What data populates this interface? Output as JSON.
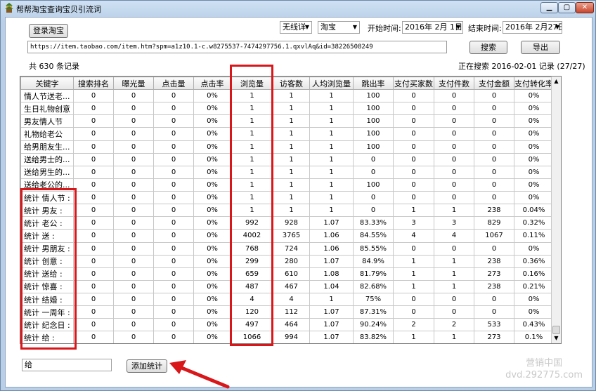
{
  "window": {
    "title": "帮帮淘宝查询宝贝引流词"
  },
  "toolbar": {
    "login_label": "登录淘宝",
    "network_value": "无线详",
    "platform_value": "淘宝",
    "start_label": "开始时间:",
    "start_date": "2016年 2月 1日",
    "end_label": "结束时间:",
    "end_date": "2016年 2月27日",
    "url": "https://item.taobao.com/item.htm?spm=a1z10.1-c.w8275537-7474297756.1.qxvlAq&id=38226508249",
    "search_label": "搜索",
    "export_label": "导出",
    "total_text": "共 630 条记录",
    "status_text": "正在搜索 2016-02-01 记录 (27/27)"
  },
  "table": {
    "headers": [
      "关键字",
      "搜索排名",
      "曝光量",
      "点击量",
      "点击率",
      "浏览量",
      "访客数",
      "人均浏览量",
      "跳出率",
      "支付买家数",
      "支付件数",
      "支付金额",
      "支付转化率"
    ],
    "rows": [
      [
        "情人节送老...",
        "0",
        "0",
        "0",
        "0%",
        "1",
        "1",
        "1",
        "100",
        "0",
        "0",
        "0",
        "0%"
      ],
      [
        "生日礼物创意",
        "0",
        "0",
        "0",
        "0%",
        "1",
        "1",
        "1",
        "100",
        "0",
        "0",
        "0",
        "0%"
      ],
      [
        "男友情人节",
        "0",
        "0",
        "0",
        "0%",
        "1",
        "1",
        "1",
        "100",
        "0",
        "0",
        "0",
        "0%"
      ],
      [
        "礼物给老公",
        "0",
        "0",
        "0",
        "0%",
        "1",
        "1",
        "1",
        "100",
        "0",
        "0",
        "0",
        "0%"
      ],
      [
        "给男朋友生...",
        "0",
        "0",
        "0",
        "0%",
        "1",
        "1",
        "1",
        "100",
        "0",
        "0",
        "0",
        "0%"
      ],
      [
        "送给男士的...",
        "0",
        "0",
        "0",
        "0%",
        "1",
        "1",
        "1",
        "0",
        "0",
        "0",
        "0",
        "0%"
      ],
      [
        "送给男生的...",
        "0",
        "0",
        "0",
        "0%",
        "1",
        "1",
        "1",
        "0",
        "0",
        "0",
        "0",
        "0%"
      ],
      [
        "送给老公的...",
        "0",
        "0",
        "0",
        "0%",
        "1",
        "1",
        "1",
        "100",
        "0",
        "0",
        "0",
        "0%"
      ],
      [
        "统计 情人节 :",
        "0",
        "0",
        "0",
        "0%",
        "1",
        "1",
        "1",
        "0",
        "0",
        "0",
        "0",
        "0%"
      ],
      [
        "统计 男友 :",
        "0",
        "0",
        "0",
        "0%",
        "1",
        "1",
        "1",
        "0",
        "1",
        "1",
        "238",
        "0.04%"
      ],
      [
        "统计 老公 :",
        "0",
        "0",
        "0",
        "0%",
        "992",
        "928",
        "1.07",
        "83.33%",
        "3",
        "3",
        "829",
        "0.32%"
      ],
      [
        "统计 送 :",
        "0",
        "0",
        "0",
        "0%",
        "4002",
        "3765",
        "1.06",
        "84.55%",
        "4",
        "4",
        "1067",
        "0.11%"
      ],
      [
        "统计 男朋友 :",
        "0",
        "0",
        "0",
        "0%",
        "768",
        "724",
        "1.06",
        "85.55%",
        "0",
        "0",
        "0",
        "0%"
      ],
      [
        "统计 创意 :",
        "0",
        "0",
        "0",
        "0%",
        "299",
        "280",
        "1.07",
        "84.9%",
        "1",
        "1",
        "238",
        "0.36%"
      ],
      [
        "统计 送给 :",
        "0",
        "0",
        "0",
        "0%",
        "659",
        "610",
        "1.08",
        "81.79%",
        "1",
        "1",
        "273",
        "0.16%"
      ],
      [
        "统计 惊喜 :",
        "0",
        "0",
        "0",
        "0%",
        "487",
        "467",
        "1.04",
        "82.68%",
        "1",
        "1",
        "238",
        "0.21%"
      ],
      [
        "统计 结婚 :",
        "0",
        "0",
        "0",
        "0%",
        "4",
        "4",
        "1",
        "75%",
        "0",
        "0",
        "0",
        "0%"
      ],
      [
        "统计 一周年 :",
        "0",
        "0",
        "0",
        "0%",
        "120",
        "112",
        "1.07",
        "87.31%",
        "0",
        "0",
        "0",
        "0%"
      ],
      [
        "统计 纪念日 :",
        "0",
        "0",
        "0",
        "0%",
        "497",
        "464",
        "1.07",
        "90.24%",
        "2",
        "2",
        "533",
        "0.43%"
      ],
      [
        "统计 给 :",
        "0",
        "0",
        "0",
        "0%",
        "1066",
        "994",
        "1.07",
        "83.82%",
        "1",
        "1",
        "273",
        "0.1%"
      ]
    ]
  },
  "footer": {
    "stat_input_value": "给",
    "add_stat_label": "添加统计"
  },
  "watermark": {
    "line1": "营销中国",
    "line2": "dvd.292775.com"
  },
  "colors": {
    "highlight": "#d8171b",
    "window_frame": "#b8cfe7"
  },
  "icons": {
    "app": "pagoda-icon",
    "minimize": "minimize-icon",
    "maximize": "maximize-icon",
    "close": "close-icon",
    "dropdown": "chevron-down-icon"
  }
}
